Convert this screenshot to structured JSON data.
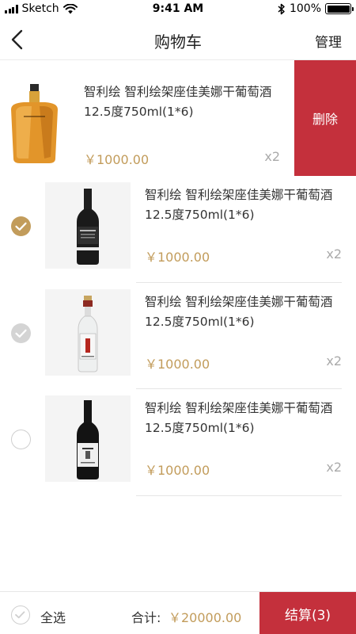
{
  "status_bar": {
    "carrier": "Sketch",
    "time": "9:41 AM",
    "battery": "100%"
  },
  "nav": {
    "title": "购物车",
    "manage_label": "管理"
  },
  "swipe": {
    "delete_label": "删除"
  },
  "items": [
    {
      "name": "智利绘 智利绘架座佳美娜干葡萄酒12.5度750ml(1*6)",
      "price": "￥1000.00",
      "qty": "x2",
      "state": "swiped"
    },
    {
      "name": "智利绘 智利绘架座佳美娜干葡萄酒12.5度750ml(1*6)",
      "price": "￥1000.00",
      "qty": "x2",
      "state": "checked"
    },
    {
      "name": "智利绘 智利绘架座佳美娜干葡萄酒12.5度750ml(1*6)",
      "price": "￥1000.00",
      "qty": "x2",
      "state": "disabled"
    },
    {
      "name": "智利绘 智利绘架座佳美娜干葡萄酒12.5度750ml(1*6)",
      "price": "￥1000.00",
      "qty": "x2",
      "state": "unchecked"
    }
  ],
  "bottom": {
    "select_all_label": "全选",
    "total_label": "合计:",
    "total_value": "￥20000.00",
    "checkout_label": "结算(3)"
  },
  "colors": {
    "accent_gold": "#c29c5b",
    "danger_red": "#c4303c"
  }
}
